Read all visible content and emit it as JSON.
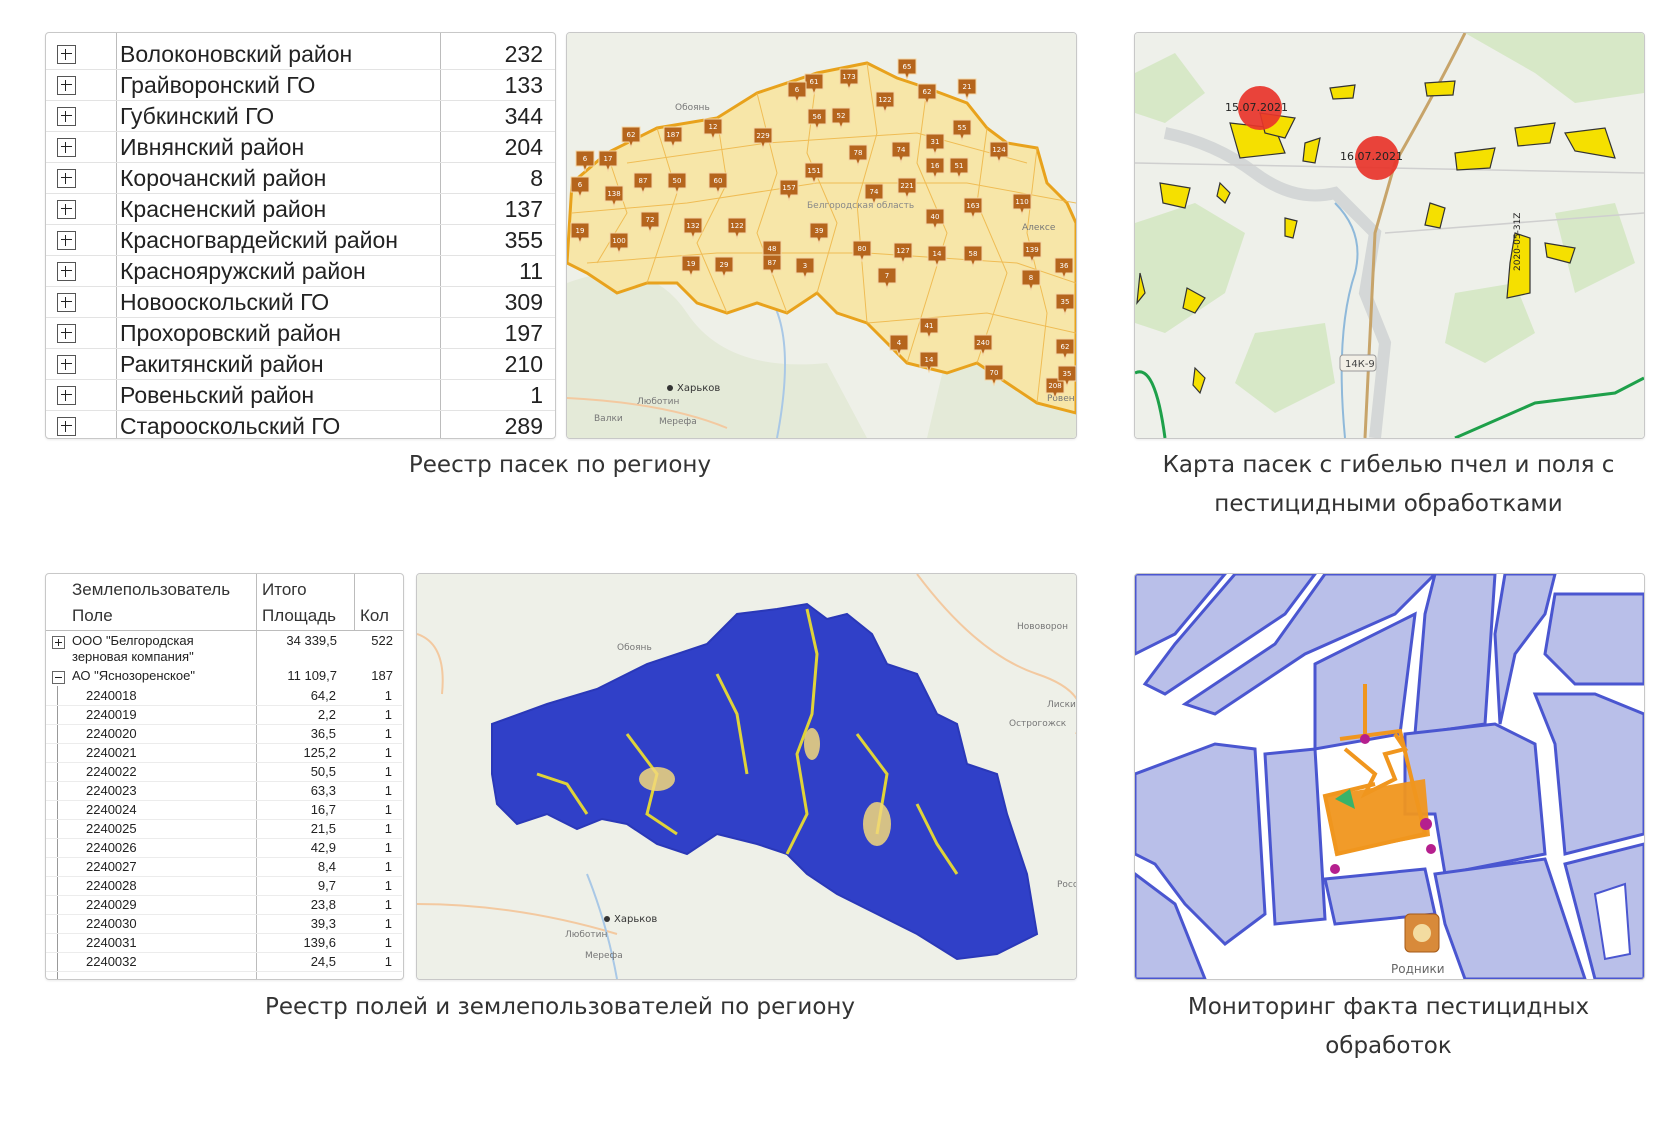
{
  "captions": {
    "apiary_registry": "Реестр пасек по региону",
    "deaths_map_line1": "Карта пасек с гибелью пчел и поля с",
    "deaths_map_line2": "пестицидными обработками",
    "fields_registry": "Реестр  полей и землепользователей по региону",
    "monitoring_line1": "Мониторинг факта пестицидных",
    "monitoring_line2": "обработок"
  },
  "regions_table": {
    "rows": [
      {
        "name": "Волоконовский район",
        "value": "232"
      },
      {
        "name": "Грайворонский ГО",
        "value": "133"
      },
      {
        "name": "Губкинский ГО",
        "value": "344"
      },
      {
        "name": "Ивнянский район",
        "value": "204"
      },
      {
        "name": "Корочанский район",
        "value": "8"
      },
      {
        "name": "Красненский район",
        "value": "137"
      },
      {
        "name": "Красногвардейский район",
        "value": "355"
      },
      {
        "name": "Краснояружский район",
        "value": "11"
      },
      {
        "name": "Новооскольский ГО",
        "value": "309"
      },
      {
        "name": "Прохоровский район",
        "value": "197"
      },
      {
        "name": "Ракитянский район",
        "value": "210"
      },
      {
        "name": "Ровеньский район",
        "value": "1"
      },
      {
        "name": "Старооскольский ГО",
        "value": "289"
      }
    ]
  },
  "apiary_map": {
    "places": {
      "oboyan": "Обоянь",
      "kharkov": "Харьков",
      "lyubotin": "Любoтин",
      "merefa": "Мерефа",
      "valki": "Валки",
      "belgorod": "Белгородская область",
      "alekseevka": "Алексе",
      "rovenki": "Ровен"
    },
    "markers": [
      "65",
      "61",
      "173",
      "6",
      "21",
      "62",
      "122",
      "56",
      "52",
      "12",
      "62",
      "187",
      "229",
      "55",
      "31",
      "124",
      "6",
      "17",
      "78",
      "74",
      "16",
      "51",
      "87",
      "50",
      "60",
      "151",
      "6",
      "138",
      "157",
      "74",
      "221",
      "40",
      "163",
      "110",
      "72",
      "132",
      "122",
      "39",
      "19",
      "100",
      "48",
      "87",
      "80",
      "127",
      "14",
      "58",
      "139",
      "36",
      "19",
      "29",
      "3",
      "7",
      "8",
      "35",
      "41",
      "240",
      "62",
      "4",
      "14",
      "70",
      "208",
      "35"
    ]
  },
  "deaths_map": {
    "dates": [
      "15.07.2021",
      "16.07.2021"
    ],
    "road": "14К-9",
    "vertical_label": "2020-05-31Z"
  },
  "fields_table": {
    "headers": {
      "owner": "Землепользователь",
      "field": "Поле",
      "total": "Итого",
      "area": "Площадь",
      "count": "Кол"
    },
    "groups": [
      {
        "name_line1": "ООО \"Белгородская",
        "name_line2": "зерновая компания\"",
        "area": "34 339,5",
        "count": "522"
      },
      {
        "name": "АО \"Яснозоренское\"",
        "area": "11 109,7",
        "count": "187"
      }
    ],
    "rows": [
      {
        "id": "2240018",
        "area": "64,2",
        "count": "1"
      },
      {
        "id": "2240019",
        "area": "2,2",
        "count": "1"
      },
      {
        "id": "2240020",
        "area": "36,5",
        "count": "1"
      },
      {
        "id": "2240021",
        "area": "125,2",
        "count": "1"
      },
      {
        "id": "2240022",
        "area": "50,5",
        "count": "1"
      },
      {
        "id": "2240023",
        "area": "63,3",
        "count": "1"
      },
      {
        "id": "2240024",
        "area": "16,7",
        "count": "1"
      },
      {
        "id": "2240025",
        "area": "21,5",
        "count": "1"
      },
      {
        "id": "2240026",
        "area": "42,9",
        "count": "1"
      },
      {
        "id": "2240027",
        "area": "8,4",
        "count": "1"
      },
      {
        "id": "2240028",
        "area": "9,7",
        "count": "1"
      },
      {
        "id": "2240029",
        "area": "23,8",
        "count": "1"
      },
      {
        "id": "2240030",
        "area": "39,3",
        "count": "1"
      },
      {
        "id": "2240031",
        "area": "139,6",
        "count": "1"
      },
      {
        "id": "2240032",
        "area": "24,5",
        "count": "1"
      }
    ]
  },
  "fields_map": {
    "places": {
      "oboyan": "Обоянь",
      "kharkov": "Харьков",
      "lyubotin": "Любoтин",
      "merefa": "Мерефа",
      "novovoronezh": "Нововорон",
      "liski": "Лиски",
      "ostrogozhsk": "Острогожск",
      "ross": "Росс"
    }
  },
  "monitoring_map": {
    "place": "Родники"
  },
  "colors": {
    "apiary_orange": "#e8a21c",
    "marker_brown": "#b5651d",
    "field_blue": "#3040c8",
    "field_yellow": "#f2e32a",
    "death_red": "#e8342a",
    "parcel_lavender": "#b9bfe9",
    "treatment_orange": "#f0961e"
  }
}
